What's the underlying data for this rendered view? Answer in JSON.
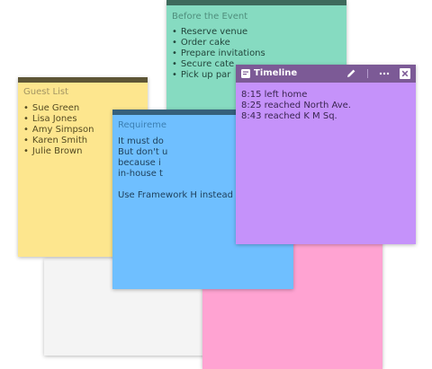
{
  "notes": {
    "white": {
      "color": "#f4f4f4"
    },
    "pink": {
      "color": "#ffa3d2"
    },
    "yellow": {
      "color": "#fde68e",
      "strip_color": "#5e5636",
      "title": "Guest List",
      "items": [
        "Sue Green",
        "Lisa Jones",
        "Amy Simpson",
        "Karen Smith",
        "Julie Brown"
      ]
    },
    "green": {
      "color": "#86dbc1",
      "strip_color": "#3e6a5c",
      "title": "Before the Event",
      "items": [
        "Reserve venue",
        "Order cake",
        "Prepare invitations",
        "Secure cate",
        "Pick up par"
      ]
    },
    "blue": {
      "color": "#6fbfff",
      "strip_color": "#35607c",
      "title": "Requireme",
      "body": "It must do\nBut don't u\nbecause i\nin-house t\n\nUse Framework H instead"
    },
    "purple": {
      "color": "#c592fa",
      "header_color": "#7c5a96",
      "title": "Timeline",
      "lines": [
        "8:15 left home",
        "8:25 reached North Ave.",
        "8:43 reached K M Sq."
      ],
      "icons": [
        "note-icon",
        "pencil-icon",
        "more-icon",
        "close-icon"
      ]
    }
  }
}
